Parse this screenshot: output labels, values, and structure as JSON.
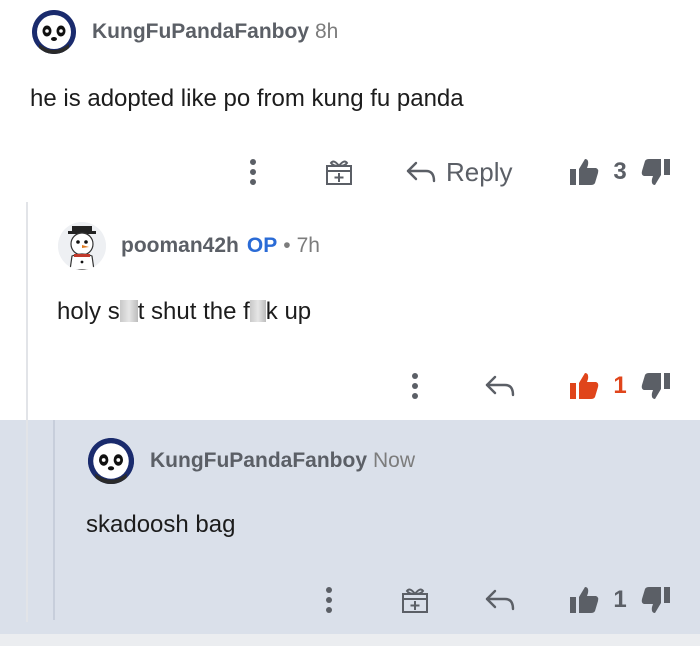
{
  "comments": [
    {
      "username": "KungFuPandaFanboy",
      "time": "8h",
      "text": "he is adopted like po from kung fu panda",
      "reply_label": "Reply",
      "score": "3"
    },
    {
      "username": "pooman42h",
      "op_badge": "OP",
      "separator": "•",
      "time": "7h",
      "text_parts": [
        "holy s",
        "t shut the f",
        "k up"
      ],
      "score": "1"
    },
    {
      "username": "KungFuPandaFanboy",
      "time": "Now",
      "text": "skadoosh bag",
      "score": "1"
    }
  ],
  "colors": {
    "upvote_active": "#e0451b",
    "op_badge": "#2a6bd6",
    "highlight_bg": "#dae0ea"
  },
  "icons": [
    "more-vertical-icon",
    "award-gift-icon",
    "reply-arrow-icon",
    "upvote-icon",
    "downvote-icon"
  ]
}
